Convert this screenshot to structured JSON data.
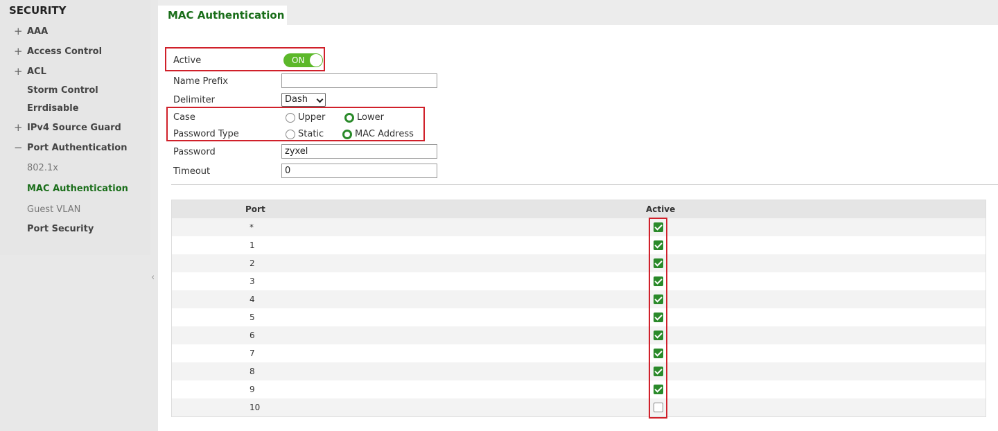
{
  "sidebar": {
    "title": "SECURITY",
    "items": [
      {
        "sign": "+",
        "label": "AAA"
      },
      {
        "sign": "+",
        "label": "Access Control"
      },
      {
        "sign": "+",
        "label": "ACL"
      },
      {
        "sign": "",
        "label": "Storm Control"
      },
      {
        "sign": "",
        "label": "Errdisable"
      },
      {
        "sign": "+",
        "label": "IPv4 Source Guard"
      },
      {
        "sign": "−",
        "label": "Port Authentication"
      },
      {
        "sign": "",
        "label": "802.1x"
      },
      {
        "sign": "",
        "label": "MAC Authentication"
      },
      {
        "sign": "",
        "label": "Guest VLAN"
      },
      {
        "sign": "",
        "label": "Port Security"
      }
    ],
    "collapse_glyph": "‹"
  },
  "tab": {
    "label": "MAC Authentication"
  },
  "form": {
    "active_label": "Active",
    "active_toggle": "ON",
    "name_prefix_label": "Name Prefix",
    "name_prefix_value": "",
    "delimiter_label": "Delimiter",
    "delimiter_value": "Dash",
    "case_label": "Case",
    "case_options": [
      "Upper",
      "Lower"
    ],
    "case_selected": "Lower",
    "password_type_label": "Password Type",
    "password_type_options": [
      "Static",
      "MAC Address"
    ],
    "password_type_selected": "MAC Address",
    "password_label": "Password",
    "password_value": "zyxel",
    "timeout_label": "Timeout",
    "timeout_value": "0"
  },
  "table": {
    "headers": {
      "port": "Port",
      "active": "Active"
    },
    "rows": [
      {
        "port": "*",
        "active": true
      },
      {
        "port": "1",
        "active": true
      },
      {
        "port": "2",
        "active": true
      },
      {
        "port": "3",
        "active": true
      },
      {
        "port": "4",
        "active": true
      },
      {
        "port": "5",
        "active": true
      },
      {
        "port": "6",
        "active": true
      },
      {
        "port": "7",
        "active": true
      },
      {
        "port": "8",
        "active": true
      },
      {
        "port": "9",
        "active": true
      },
      {
        "port": "10",
        "active": false
      }
    ]
  },
  "colors": {
    "accent": "#2a8a2a",
    "toggle": "#5cb82a",
    "highlight": "#d0202a"
  }
}
